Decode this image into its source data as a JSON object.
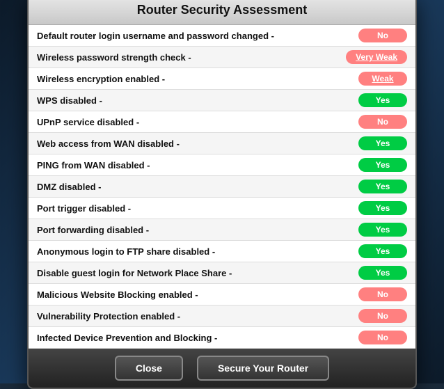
{
  "dialog": {
    "title": "Router Security Assessment",
    "rows": [
      {
        "label": "Default router login username and password changed -",
        "badge": "No",
        "badge_type": "no"
      },
      {
        "label": "Wireless password strength check -",
        "badge": "Very Weak",
        "badge_type": "very-weak"
      },
      {
        "label": "Wireless encryption enabled -",
        "badge": "Weak",
        "badge_type": "weak"
      },
      {
        "label": "WPS disabled -",
        "badge": "Yes",
        "badge_type": "yes"
      },
      {
        "label": "UPnP service disabled -",
        "badge": "No",
        "badge_type": "no"
      },
      {
        "label": "Web access from WAN disabled -",
        "badge": "Yes",
        "badge_type": "yes"
      },
      {
        "label": "PING from WAN disabled -",
        "badge": "Yes",
        "badge_type": "yes"
      },
      {
        "label": "DMZ disabled -",
        "badge": "Yes",
        "badge_type": "yes"
      },
      {
        "label": "Port trigger disabled -",
        "badge": "Yes",
        "badge_type": "yes"
      },
      {
        "label": "Port forwarding disabled -",
        "badge": "Yes",
        "badge_type": "yes"
      },
      {
        "label": "Anonymous login to FTP share disabled -",
        "badge": "Yes",
        "badge_type": "yes"
      },
      {
        "label": "Disable guest login for Network Place Share -",
        "badge": "Yes",
        "badge_type": "yes"
      },
      {
        "label": "Malicious Website Blocking enabled -",
        "badge": "No",
        "badge_type": "no"
      },
      {
        "label": "Vulnerability Protection enabled -",
        "badge": "No",
        "badge_type": "no"
      },
      {
        "label": "Infected Device Prevention and Blocking -",
        "badge": "No",
        "badge_type": "no"
      }
    ],
    "footer": {
      "close_label": "Close",
      "secure_label": "Secure Your Router"
    }
  }
}
